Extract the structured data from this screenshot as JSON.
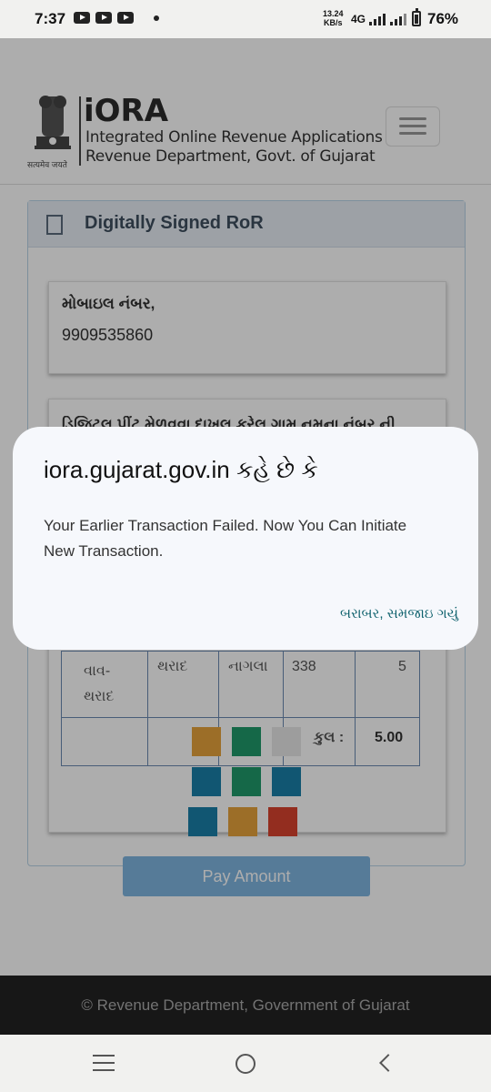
{
  "status_bar": {
    "time": "7:37",
    "speed_value": "13.24",
    "speed_unit": "KB/s",
    "network": "4G",
    "battery": "76%"
  },
  "header": {
    "app_name": "iORA",
    "subtitle_1": "Integrated Online Revenue Applications",
    "subtitle_2": "Revenue Department, Govt. of Gujarat",
    "emblem_motto": "सत्यमेव जयते"
  },
  "card": {
    "title": "Digitally Signed RoR",
    "mobile_label": "મોબાઇલ નંબર,",
    "mobile_value": "9909535860",
    "form_label": "ડિજિટલ પ્રીંટ મેળવવા દાખલ કરેલ ગામ નમુના નંબર ની"
  },
  "table": {
    "row": [
      "વાવ-\nથરાદ",
      "થરાદ",
      "નાગલા",
      "338",
      "5"
    ],
    "total_label": "કુલ :",
    "total_value": "5.00"
  },
  "captcha_colors": [
    "#e6a33c",
    "#1f9a6a",
    "#e8e8e8",
    "#1a7fa8",
    "#1f9a6a",
    "#1a7fa8",
    "#1a7fa8",
    "#e6a33c",
    "#d9432f"
  ],
  "pay_button": "Pay Amount",
  "footer": "© Revenue Department, Government of Gujarat",
  "dialog": {
    "title": "iora.gujarat.gov.in કહે છે કે",
    "message": "Your Earlier Transaction Failed. Now You Can Initiate New Transaction.",
    "ok_button": "બરાબર, સમજાઇ ગયું"
  },
  "icons": {
    "status": [
      "youtube-icon",
      "youtube-icon",
      "youtube-icon",
      "signal-icon",
      "signal-icon",
      "battery-icon"
    ],
    "nav": [
      "recent-apps-icon",
      "home-icon",
      "back-icon"
    ]
  }
}
